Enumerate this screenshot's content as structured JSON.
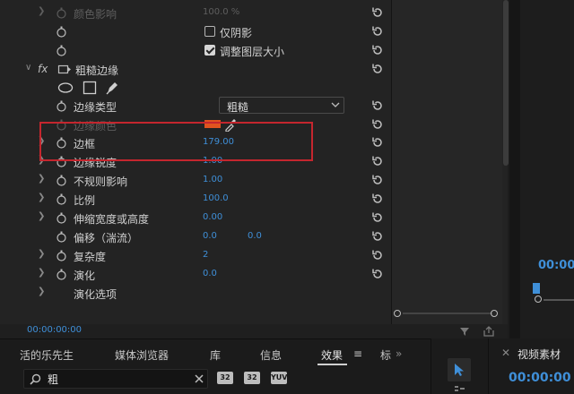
{
  "effect_controls": {
    "rows": [
      {
        "label": "颜色影响",
        "value": "100.0 %"
      },
      {
        "checkbox_label": "仅阴影",
        "checked": false
      },
      {
        "checkbox_label": "调整图层大小",
        "checked": true
      },
      {
        "fx": "fx",
        "label": "粗糙边缘"
      },
      {
        "label": "边缘类型",
        "dropdown_value": "粗糙"
      },
      {
        "label": "边缘颜色",
        "swatch_color": "#e0541f"
      },
      {
        "label": "边框",
        "value": "179.00"
      },
      {
        "label": "边缘锐度",
        "value": "1.00"
      },
      {
        "label": "不规则影响",
        "value": "1.00"
      },
      {
        "label": "比例",
        "value": "100.0"
      },
      {
        "label": "伸缩宽度或高度",
        "value": "0.00"
      },
      {
        "label": "偏移（湍流）",
        "value_x": "0.0",
        "value_y": "0.0"
      },
      {
        "label": "复杂度",
        "value": "2"
      },
      {
        "label": "演化",
        "value": "0.0"
      },
      {
        "label": "演化选项"
      }
    ],
    "timecode": "00:00:00:00"
  },
  "bottom_tabs": {
    "items": [
      "活的乐先生",
      "媒体浏览器",
      "库",
      "信息",
      "效果",
      "标"
    ],
    "menu_icon": "≡",
    "more": "»"
  },
  "search": {
    "value": "粗",
    "badges": [
      "32",
      "32",
      "YUV"
    ]
  },
  "right_panel": {
    "timecode_top": "00:00",
    "tab_label": "视频素材",
    "timecode_bottom": "00:00:00"
  },
  "colors": {
    "accent_blue": "#3f8fd8",
    "highlight_red": "#c4262e",
    "edge_color_swatch": "#e0541f"
  }
}
